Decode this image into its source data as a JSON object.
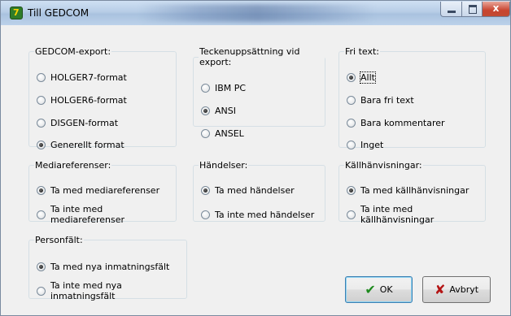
{
  "window": {
    "title": "Till GEDCOM",
    "app_icon_glyph": "7",
    "minimize_label": "",
    "maximize_label": "",
    "close_label": "x"
  },
  "groups": {
    "gedcom_export": {
      "legend": "GEDCOM-export:",
      "options": [
        "HOLGER7-format",
        "HOLGER6-format",
        "DISGEN-format",
        "Generellt format"
      ],
      "selected": 3
    },
    "charset": {
      "legend": "Teckenuppsättning vid export:",
      "options": [
        "IBM PC",
        "ANSI",
        "ANSEL"
      ],
      "selected": 1
    },
    "free_text": {
      "legend": "Fri text:",
      "options": [
        "Allt",
        "Bara fri text",
        "Bara kommentarer",
        "Inget"
      ],
      "selected": 0
    },
    "media": {
      "legend": "Mediareferenser:",
      "options": [
        "Ta med mediareferenser",
        "Ta inte med mediareferenser"
      ],
      "selected": 0
    },
    "events": {
      "legend": "Händelser:",
      "options": [
        "Ta med händelser",
        "Ta inte med händelser"
      ],
      "selected": 0
    },
    "sources": {
      "legend": "Källhänvisningar:",
      "options": [
        "Ta med källhänvisningar",
        "Ta inte med källhänvisningar"
      ],
      "selected": 0
    },
    "person_fields": {
      "legend": "Personfält:",
      "options": [
        "Ta med nya inmatningsfält",
        "Ta inte med nya inmatningsfält"
      ],
      "selected": 0
    }
  },
  "buttons": {
    "ok": "OK",
    "cancel": "Avbryt"
  },
  "icons": {
    "ok": "check-icon",
    "cancel": "cross-icon"
  },
  "colors": {
    "titlebar": "#bcd2ea",
    "close_button": "#c8442f",
    "ok_icon": "#1e8a1e",
    "cancel_icon": "#b41414"
  }
}
